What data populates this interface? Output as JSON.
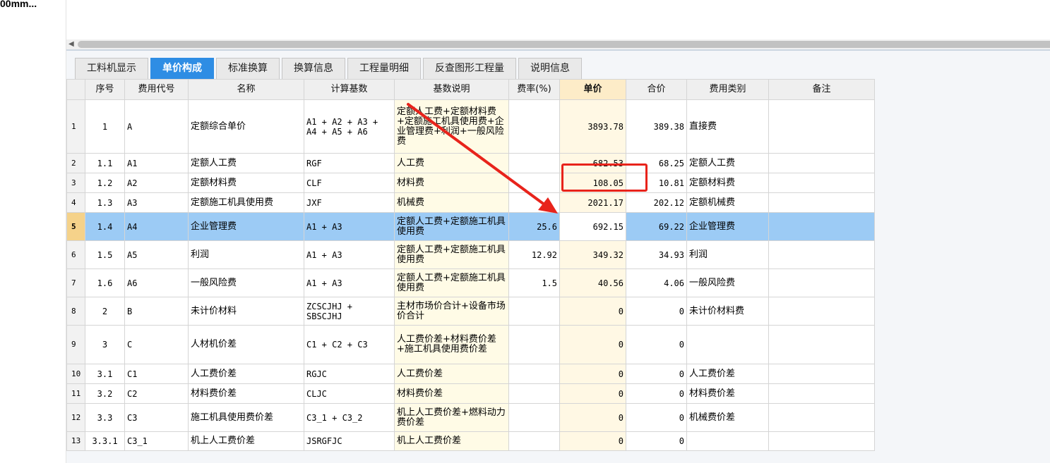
{
  "left_panel": {
    "truncated_text": "00mm..."
  },
  "tabs": [
    {
      "label": "工料机显示",
      "active": false
    },
    {
      "label": "单价构成",
      "active": true
    },
    {
      "label": "标准换算",
      "active": false
    },
    {
      "label": "换算信息",
      "active": false
    },
    {
      "label": "工程量明细",
      "active": false
    },
    {
      "label": "反查图形工程量",
      "active": false
    },
    {
      "label": "说明信息",
      "active": false
    }
  ],
  "columns": [
    "",
    "序号",
    "费用代号",
    "名称",
    "计算基数",
    "基数说明",
    "费率(%)",
    "单价",
    "合价",
    "费用类别",
    "备注"
  ],
  "rows": [
    {
      "num": "1",
      "seq": "1",
      "code": "A",
      "name": "定额综合单价",
      "base": "A1 + A2 + A3 + A4 + A5 + A6",
      "desc": "定额人工费+定额材料费+定额施工机具使用费+企业管理费+利润+一般风险费",
      "rate": "",
      "price": "3893.78",
      "total": "389.38",
      "category": "直接费",
      "note": ""
    },
    {
      "num": "2",
      "seq": "1.1",
      "code": "A1",
      "name": "定额人工费",
      "base": "RGF",
      "desc": "人工费",
      "rate": "",
      "price": "682.53",
      "total": "68.25",
      "category": "定额人工费",
      "note": ""
    },
    {
      "num": "3",
      "seq": "1.2",
      "code": "A2",
      "name": "定额材料费",
      "base": "CLF",
      "desc": "材料费",
      "rate": "",
      "price": "108.05",
      "total": "10.81",
      "category": "定额材料费",
      "note": ""
    },
    {
      "num": "4",
      "seq": "1.3",
      "code": "A3",
      "name": "定额施工机具使用费",
      "base": "JXF",
      "desc": "机械费",
      "rate": "",
      "price": "2021.17",
      "total": "202.12",
      "category": "定额机械费",
      "note": ""
    },
    {
      "num": "5",
      "seq": "1.4",
      "code": "A4",
      "name": "企业管理费",
      "base": "A1 + A3",
      "desc": "定额人工费+定额施工机具使用费",
      "rate": "25.6",
      "price": "692.15",
      "total": "69.22",
      "category": "企业管理费",
      "note": ""
    },
    {
      "num": "6",
      "seq": "1.5",
      "code": "A5",
      "name": "利润",
      "base": "A1 + A3",
      "desc": "定额人工费+定额施工机具使用费",
      "rate": "12.92",
      "price": "349.32",
      "total": "34.93",
      "category": "利润",
      "note": ""
    },
    {
      "num": "7",
      "seq": "1.6",
      "code": "A6",
      "name": "一般风险费",
      "base": "A1 + A3",
      "desc": "定额人工费+定额施工机具使用费",
      "rate": "1.5",
      "price": "40.56",
      "total": "4.06",
      "category": "一般风险费",
      "note": ""
    },
    {
      "num": "8",
      "seq": "2",
      "code": "B",
      "name": "未计价材料",
      "base": "ZCSCJHJ + SBSCJHJ",
      "desc": "主材市场价合计+设备市场价合计",
      "rate": "",
      "price": "0",
      "total": "0",
      "category": "未计价材料费",
      "note": ""
    },
    {
      "num": "9",
      "seq": "3",
      "code": "C",
      "name": "人材机价差",
      "base": "C1 + C2 + C3",
      "desc": "人工费价差+材料费价差+施工机具使用费价差",
      "rate": "",
      "price": "0",
      "total": "0",
      "category": "",
      "note": ""
    },
    {
      "num": "10",
      "seq": "3.1",
      "code": "C1",
      "name": "人工费价差",
      "base": "RGJC",
      "desc": "人工费价差",
      "rate": "",
      "price": "0",
      "total": "0",
      "category": "人工费价差",
      "note": ""
    },
    {
      "num": "11",
      "seq": "3.2",
      "code": "C2",
      "name": "材料费价差",
      "base": "CLJC",
      "desc": "材料费价差",
      "rate": "",
      "price": "0",
      "total": "0",
      "category": "材料费价差",
      "note": ""
    },
    {
      "num": "12",
      "seq": "3.3",
      "code": "C3",
      "name": "施工机具使用费价差",
      "base": "C3_1 + C3_2",
      "desc": "机上人工费价差+燃料动力费价差",
      "rate": "",
      "price": "0",
      "total": "0",
      "category": "机械费价差",
      "note": ""
    },
    {
      "num": "13",
      "seq": "3.3.1",
      "code": "C3_1",
      "name": "机上人工费价差",
      "base": "JSRGFJC",
      "desc": "机上人工费价差",
      "rate": "",
      "price": "0",
      "total": "0",
      "category": "",
      "note": ""
    }
  ],
  "selected_row": 5,
  "colors": {
    "tab_active": "#2e8de4",
    "selected_row": "#9ccbf5",
    "annotation": "#e8231b"
  }
}
